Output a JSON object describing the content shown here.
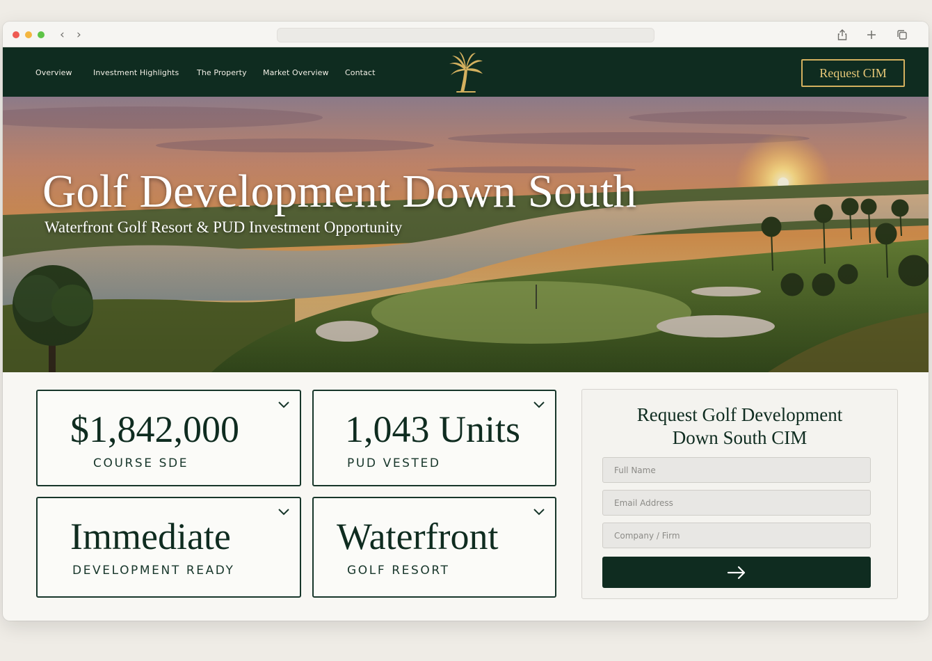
{
  "nav": {
    "links": [
      "Overview",
      "Investment Highlights",
      "The Property",
      "Market Overview",
      "Contact"
    ],
    "cta_label": "Request CIM"
  },
  "hero": {
    "title": "Golf Development Down South",
    "subtitle": "Waterfront Golf Resort & PUD Investment Opportunity"
  },
  "stats": [
    {
      "value": "$1,842,000",
      "label": "COURSE SDE"
    },
    {
      "value": "1,043 Units",
      "label": "PUD VESTED"
    },
    {
      "value": "Immediate",
      "label": "DEVELOPMENT READY"
    },
    {
      "value": "Waterfront",
      "label": "GOLF RESORT"
    }
  ],
  "form": {
    "title_line1": "Request Golf Development",
    "title_line2": "Down South CIM",
    "fields": [
      {
        "placeholder": "Full Name"
      },
      {
        "placeholder": "Email Address"
      },
      {
        "placeholder": "Company / Firm"
      }
    ],
    "submit_icon": "arrow-right-icon"
  },
  "colors": {
    "brand_green": "#0f2c20",
    "accent_gold": "#d4b15f",
    "page_bg": "#f8f7f3"
  }
}
